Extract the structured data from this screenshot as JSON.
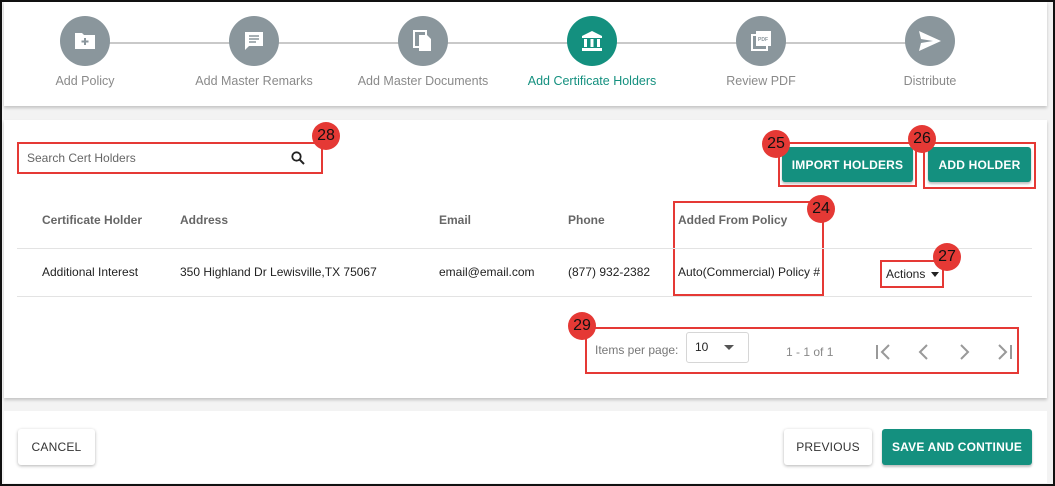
{
  "stepper": {
    "steps": [
      {
        "label": "Add Policy",
        "icon": "folder-plus-icon"
      },
      {
        "label": "Add Master Remarks",
        "icon": "comment-icon"
      },
      {
        "label": "Add Master Documents",
        "icon": "documents-icon"
      },
      {
        "label": "Add Certificate Holders",
        "icon": "bank-icon",
        "active": true
      },
      {
        "label": "Review PDF",
        "icon": "pdf-icon"
      },
      {
        "label": "Distribute",
        "icon": "send-icon"
      }
    ]
  },
  "search": {
    "placeholder": "Search Cert Holders"
  },
  "buttons": {
    "import": "IMPORT HOLDERS",
    "add": "ADD HOLDER",
    "cancel": "CANCEL",
    "previous": "PREVIOUS",
    "save": "SAVE AND CONTINUE"
  },
  "table": {
    "headers": [
      "Certificate Holder",
      "Address",
      "Email",
      "Phone",
      "Added From Policy"
    ],
    "rows": [
      {
        "holder": "Additional Interest",
        "address": "350 Highland Dr Lewisville,TX 75067",
        "email": "email@email.com",
        "phone": "(877) 932-2382",
        "policy": "Auto(Commercial) Policy #",
        "actions": "Actions"
      }
    ]
  },
  "pagination": {
    "items_per_page_label": "Items per page:",
    "items_per_page": "10",
    "range": "1 - 1 of 1"
  },
  "annotations": {
    "search": "28",
    "import": "25",
    "add": "26",
    "policy_column": "24",
    "actions": "27",
    "pagination": "29"
  },
  "colors": {
    "accent": "#14907f",
    "step_inactive": "#8a969c",
    "annotation": "#e53935"
  }
}
